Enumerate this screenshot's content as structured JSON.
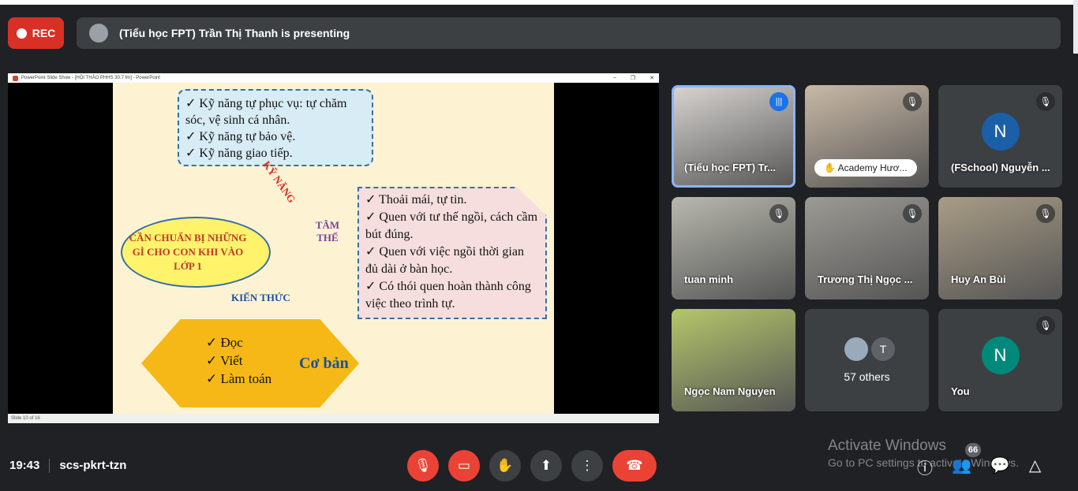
{
  "recording": {
    "label": "REC",
    "color": "#d93025"
  },
  "banner": {
    "text": "(Tiểu học FPT) Trần Thị Thanh is presenting"
  },
  "presentation": {
    "window_title": "PowerPoint Slide Show - [HỘI THẢO PHHS 30.7 fm] - PowerPoint",
    "window_controls": [
      "–",
      "❐",
      "✕"
    ],
    "status": "Slide 10 of 16",
    "slide": {
      "skills_box": [
        "✓ Kỹ năng tự phục vụ: tự chăm sóc, vệ sinh cá nhân.",
        "✓ Kỹ năng tự bảo vệ.",
        "✓ Kỹ năng giao tiếp."
      ],
      "center_cloud": "CẦN CHUẨN BỊ NHỮNG GÌ CHO CON KHI VÀO LỚP 1",
      "label_skills": "KỸ NĂNG",
      "label_mind": "TÂM THẾ",
      "label_knowledge": "KIẾN THỨC",
      "mind_box": [
        "✓ Thoải mái, tự tin.",
        "✓ Quen với tư thế ngồi, cách cầm bút đúng.",
        "✓ Quen với việc ngồi thời gian đủ dài ở bàn học.",
        "✓ Có thói quen hoàn thành công việc theo trình tự."
      ],
      "knowledge_box": [
        "✓ Đọc",
        "✓ Viết",
        "✓ Làm toán"
      ],
      "knowledge_summary": "Cơ bản"
    }
  },
  "participants": [
    {
      "name": "(Tiểu học FPT) Tr...",
      "state": "speaking",
      "video": true,
      "bg": "#d9d6d2"
    },
    {
      "name": "Academy Hươ...",
      "state": "muted",
      "video": true,
      "bg": "#c9b9a6",
      "pill": true
    },
    {
      "name": "(FSchool) Nguyễn ...",
      "state": "muted",
      "video": false,
      "initial": "N",
      "avatar_color": "#1a5fa8"
    },
    {
      "name": "tuan minh",
      "state": "muted",
      "video": true,
      "bg": "#b8b8ae"
    },
    {
      "name": "Trương Thị Ngọc ...",
      "state": "muted",
      "video": true,
      "bg": "#9c9a94"
    },
    {
      "name": "Huy An Bùi",
      "state": "muted",
      "video": true,
      "bg": "#a89c86"
    },
    {
      "name": "Ngọc Nam Nguyen",
      "state": "unmuted",
      "video": true,
      "bg": "#b4c76a"
    },
    {
      "name": "57 others",
      "state": "none",
      "video": false,
      "others": true,
      "initial": "T"
    },
    {
      "name": "You",
      "state": "muted",
      "video": false,
      "initial": "N",
      "avatar_color": "#00897b"
    }
  ],
  "bottom": {
    "time": "19:43",
    "meeting_code": "scs-pkrt-tzn",
    "participant_count": "66"
  },
  "watermark": {
    "title": "Activate Windows",
    "subtitle": "Go to PC settings to activate Windows."
  }
}
